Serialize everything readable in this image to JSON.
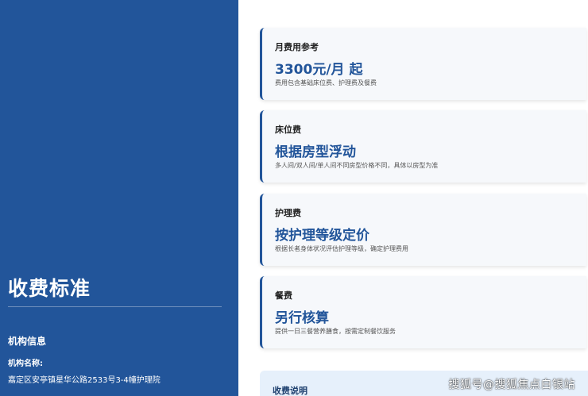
{
  "sidebar": {
    "title": "收费标准",
    "section_title": "机构信息",
    "name_label": "机构名称:",
    "address": "嘉定区安亭镇星华公路2533号3-4幢护理院"
  },
  "fees": [
    {
      "label": "月费用参考",
      "value": "3300元/月 起",
      "desc": "费用包含基础床位费、护理费及餐费"
    },
    {
      "label": "床位费",
      "value": "根据房型浮动",
      "desc": "多人间/双人间/单人间不同房型价格不同，具体以房型为准"
    },
    {
      "label": "护理费",
      "value": "按护理等级定价",
      "desc": "根据长者身体状况评估护理等级，确定护理费用"
    },
    {
      "label": "餐费",
      "value": "另行核算",
      "desc": "提供一日三餐营养膳食，按需定制餐饮服务"
    }
  ],
  "note": {
    "title": "收费说明"
  },
  "watermark": "搜狐号@搜狐焦点白银站",
  "colors": {
    "primary": "#22559a",
    "card_bg": "#f6f8fb",
    "note_bg": "#e6f0fb"
  }
}
